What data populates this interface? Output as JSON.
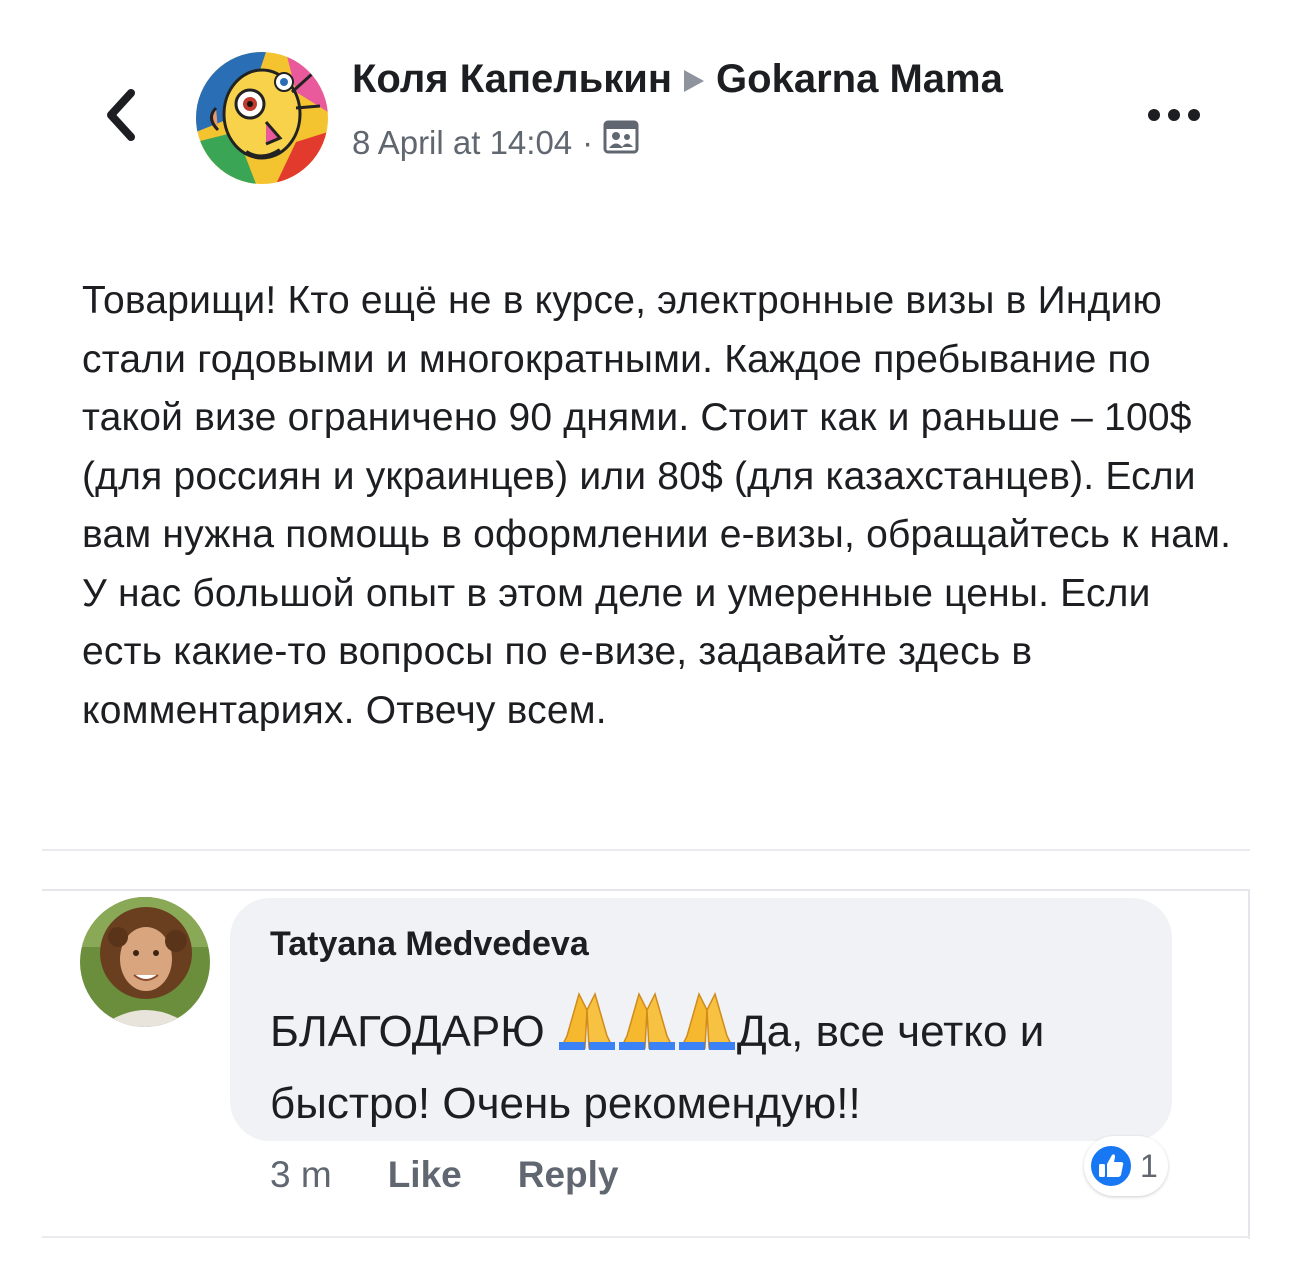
{
  "header": {
    "author": "Коля Капелькин",
    "group": "Gokarna Mama",
    "timestamp": "8 April at 14:04",
    "separator_dot": "·",
    "privacy_icon": "group-audience-icon",
    "back_icon": "chevron-left-icon",
    "more_icon": "more-horizontal-icon"
  },
  "post": {
    "text": "Товарищи! Кто ещё не в курсе, электронные визы в Индию стали годовыми и многократными. Каждое пребывание по такой визе ограничено 90 днями. Стоит как и раньше – 100$ (для россиян и украинцев) или 80$ (для казахстанцев). Если вам нужна помощь в оформлении е-визы, обращайтесь к нам. У нас большой опыт в этом деле и умеренные цены. Если есть какие-то вопросы по е-визе, задавайте здесь в комментариях. Отвечу всем."
  },
  "comment": {
    "author": "Tatyana Medvedeva",
    "text_before": "БЛАГОДАРЮ ",
    "text_after": "Да, все четко и быстро! Очень рекомендую!!",
    "emoji": "folded-hands",
    "time": "3 m",
    "like_label": "Like",
    "reply_label": "Reply",
    "reaction_count": "1"
  },
  "colors": {
    "bubble": "#f0f2f5",
    "secondary_text": "#606770",
    "like_blue": "#1877f2"
  }
}
